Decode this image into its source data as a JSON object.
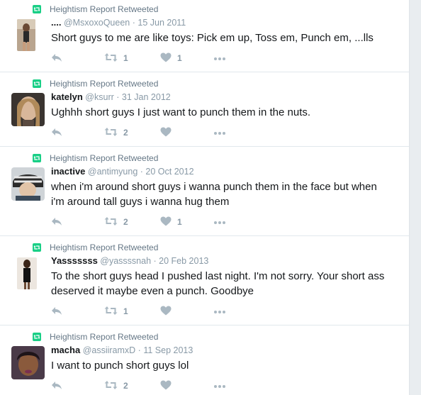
{
  "context_label": "Heightism Report Retweeted",
  "tweets": [
    {
      "name": "....",
      "handle": "@MsxoxoQueen",
      "date": "15 Jun 2011",
      "text": "Short guys to me are like toys: Pick em up, Toss em, Punch em,  ...lls",
      "retweets": "1",
      "likes": "1"
    },
    {
      "name": "katelyn",
      "handle": "@ksurr",
      "date": "31 Jan 2012",
      "text": "Ughhh short guys I just want to punch them in the nuts.",
      "retweets": "2",
      "likes": ""
    },
    {
      "name": "inactive",
      "handle": "@antimyung",
      "date": "20 Oct 2012",
      "text": "when i'm around short guys i wanna punch them in the face but when i'm around tall guys i wanna hug them",
      "retweets": "2",
      "likes": "1"
    },
    {
      "name": "Yasssssss",
      "handle": "@yassssnah",
      "date": "20 Feb 2013",
      "text": "To the short guys head I pushed last night. I'm not sorry. Your short ass deserved it maybe even a punch. Goodbye",
      "retweets": "1",
      "likes": ""
    },
    {
      "name": "macha",
      "handle": "@assiiramxD",
      "date": "11 Sep 2013",
      "text": "I want to punch short guys lol",
      "retweets": "2",
      "likes": ""
    }
  ],
  "colors": {
    "retweet_green": "#19cf86",
    "meta_gray": "#657786",
    "icon_gray": "#aab8c2"
  },
  "icons": [
    "retweet-icon",
    "reply-icon",
    "heart-icon",
    "more-icon"
  ]
}
